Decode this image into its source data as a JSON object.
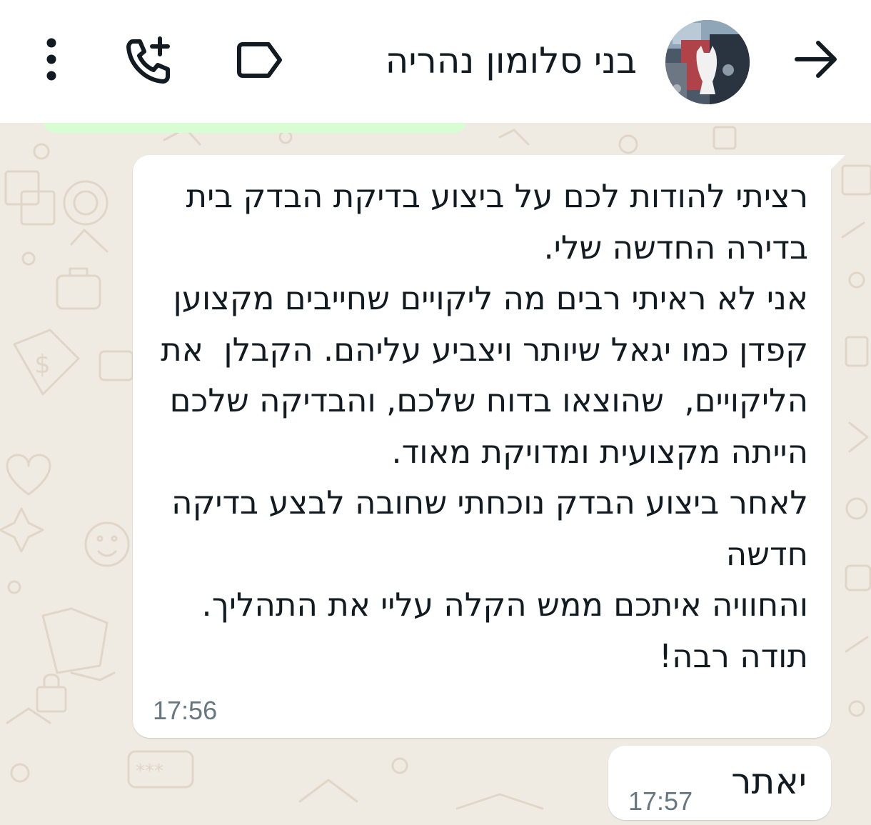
{
  "header": {
    "contact_name": "בני סלומון נהריה",
    "icons": {
      "back": "arrow-right-icon",
      "avatar": "contact-avatar",
      "label": "label-tag-icon",
      "add_call": "add-call-icon",
      "menu": "more-vert-icon"
    }
  },
  "messages": [
    {
      "direction": "incoming",
      "text": "רציתי להודות לכם על ביצוע בדיקת הבדק בית בדירה החדשה שלי.\nאני לא ראיתי רבים מה ליקויים שחייבים מקצוען קפדן כמו יגאל שיותר ויצביע עליהם. הקבלן  את הליקויים,  שהוצאו בדוח שלכם, והבדיקה שלכם הייתה מקצועית ומדויקת מאוד.\nלאחר ביצוע הבדק נוכחתי שחובה לבצע בדיקה חדשה\nוהחוויה איתכם ממש הקלה עליי את התהליך. תודה רבה!",
      "time": "17:56"
    },
    {
      "direction": "incoming",
      "text": "יאתר",
      "time": "17:57"
    }
  ],
  "colors": {
    "header_bg": "#ffffff",
    "chat_bg": "#efeae2",
    "bubble_bg": "#ffffff",
    "outgoing_bubble_bg": "#d9fdd3",
    "text": "#111b21",
    "time": "#667781",
    "icon": "#111b21"
  }
}
